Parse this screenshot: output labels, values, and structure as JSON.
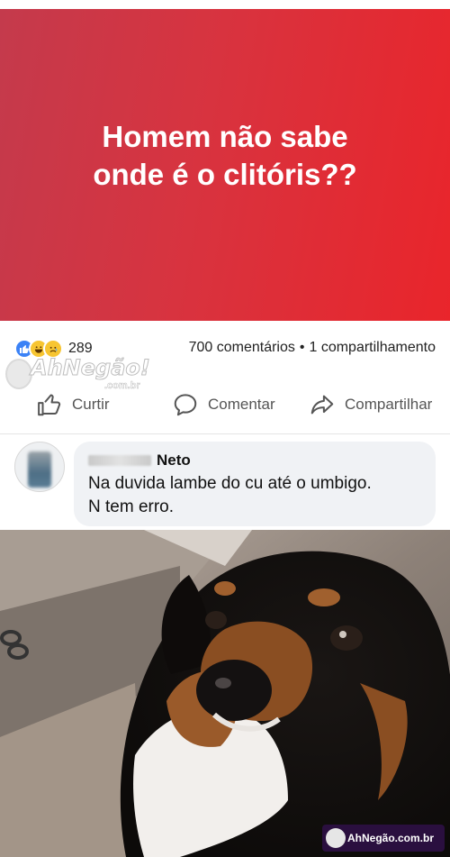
{
  "post": {
    "banner_text": "Homem não sabe onde é o clitóris??",
    "banner_colors": [
      "#c43a4c",
      "#e9252b"
    ]
  },
  "reactions": {
    "icons": [
      "like-icon",
      "haha-icon",
      "sad-icon"
    ],
    "count": "289"
  },
  "stats": {
    "comments": "700 comentários",
    "separator": "•",
    "shares": "1 compartilhamento"
  },
  "actions": {
    "like_label": "Curtir",
    "comment_label": "Comentar",
    "share_label": "Compartilhar"
  },
  "comment": {
    "author": "Neto",
    "text_line1": "Na duvida lambe do cu até o umbigo.",
    "text_line2": "N tem erro."
  },
  "watermarks": {
    "main": "AhNegão!",
    "main_sub": ".com.br",
    "corner": "AhNegão.com.br"
  },
  "accent_color": "#1877f2"
}
